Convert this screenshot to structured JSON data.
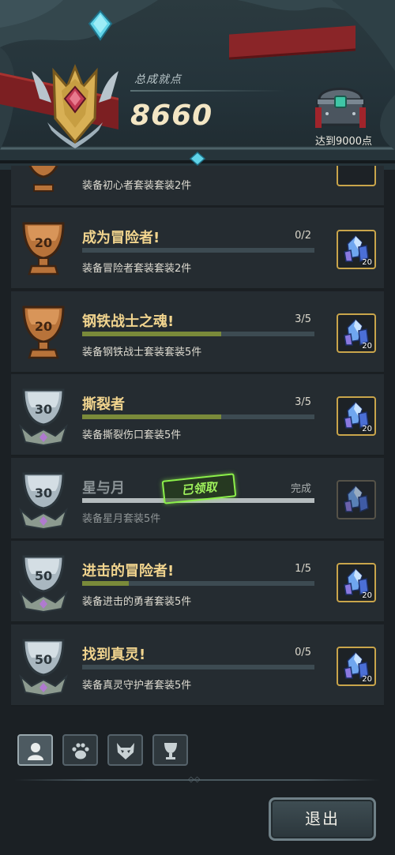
{
  "header": {
    "total_label": "总成就点",
    "total_value": "8660",
    "reach_label": "达到9000点"
  },
  "partial_top_row": {
    "desc": "装备初心者套装套装2件"
  },
  "achievements": [
    {
      "title": "成为冒险者!",
      "progress": "0/2",
      "progress_fraction": 0.0,
      "desc": "装备冒险者套装套装2件",
      "trophy": "bronze",
      "points": "20",
      "reward_count": "20",
      "done": false
    },
    {
      "title": "钢铁战士之魂!",
      "progress": "3/5",
      "progress_fraction": 0.6,
      "desc": "装备钢铁战士套装套装5件",
      "trophy": "bronze",
      "points": "20",
      "reward_count": "20",
      "done": false
    },
    {
      "title": "撕裂者",
      "progress": "3/5",
      "progress_fraction": 0.6,
      "desc": "装备撕裂伤口套装5件",
      "trophy": "silver",
      "points": "30",
      "reward_count": "20",
      "done": false
    },
    {
      "title": "星与月",
      "progress": "完成",
      "progress_fraction": 1.0,
      "desc": "装备星月套装5件",
      "trophy": "silver",
      "points": "30",
      "reward_count": "",
      "done": true,
      "stamp": "已领取"
    },
    {
      "title": "进击的冒险者!",
      "progress": "1/5",
      "progress_fraction": 0.2,
      "desc": "装备进击的勇者套装5件",
      "trophy": "silver",
      "points": "50",
      "reward_count": "20",
      "done": false
    },
    {
      "title": "找到真灵!",
      "progress": "0/5",
      "progress_fraction": 0.0,
      "desc": "装备真灵守护者套装5件",
      "trophy": "silver",
      "points": "50",
      "reward_count": "20",
      "done": false
    }
  ],
  "tabs": [
    {
      "icon": "character-icon",
      "active": true
    },
    {
      "icon": "paw-icon",
      "active": false
    },
    {
      "icon": "mask-icon",
      "active": false
    },
    {
      "icon": "trophy-icon",
      "active": false
    }
  ],
  "exit_label": "退出",
  "colors": {
    "title_gold": "#f1d48e",
    "bar_fill": "#7a8a3a",
    "stamp_green": "#8cf04a",
    "reward_border": "#c9a54b"
  }
}
